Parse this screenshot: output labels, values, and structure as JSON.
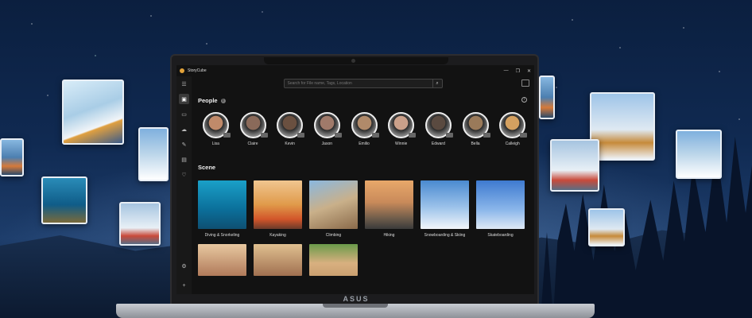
{
  "app": {
    "title": "StoryCube"
  },
  "window_controls": [
    "—",
    "❐",
    "✕"
  ],
  "search": {
    "placeholder": "Search for File name, Tags, Location"
  },
  "sections": {
    "people": "People",
    "scene": "Scene"
  },
  "people": [
    {
      "name": "Lisa",
      "color": "#c08a6a"
    },
    {
      "name": "Claire",
      "color": "#8a6a5a"
    },
    {
      "name": "Kevin",
      "color": "#6a5040"
    },
    {
      "name": "Jason",
      "color": "#a07a6a"
    },
    {
      "name": "Emilio",
      "color": "#b08a6a"
    },
    {
      "name": "Winnie",
      "color": "#caa08a"
    },
    {
      "name": "Edward",
      "color": "#5a4a40"
    },
    {
      "name": "Bella",
      "color": "#9a7a5a"
    },
    {
      "name": "Calleigh",
      "color": "#d4a060"
    }
  ],
  "scenes": [
    {
      "label": "Diving & Snorkeling",
      "bg": "linear-gradient(180deg,#1aa0c8,#0b6f9a 60%,#0e4f72)"
    },
    {
      "label": "Kayaking",
      "bg": "linear-gradient(180deg,#f0c690,#e09a4a 50%,#d2552a 80%,#6a3a2a)"
    },
    {
      "label": "Climbing",
      "bg": "linear-gradient(160deg,#8ab8e0,#c9b08a 50%,#8a6a4a)"
    },
    {
      "label": "Hiking",
      "bg": "linear-gradient(180deg,#e8a86a,#c98a5a 45%,#6a5a4a 80%,#3a3a3a)"
    },
    {
      "label": "Snowboarding & Skiing",
      "bg": "linear-gradient(180deg,#4a8ad0,#9cc2ea 55%,#f2f6fa)"
    },
    {
      "label": "Skateboarding",
      "bg": "linear-gradient(180deg,#3e7ad0,#8ab6ea 60%,#dfe9f5)"
    }
  ],
  "scenes_row2": [
    {
      "bg": "linear-gradient(180deg,#e8c8a0,#b07a5a)"
    },
    {
      "bg": "linear-gradient(180deg,#e0c090,#a07050)"
    },
    {
      "bg": "linear-gradient(180deg,#6a9a4a,#d8b080 60%,#caa070)"
    }
  ],
  "brand": "ASUS"
}
